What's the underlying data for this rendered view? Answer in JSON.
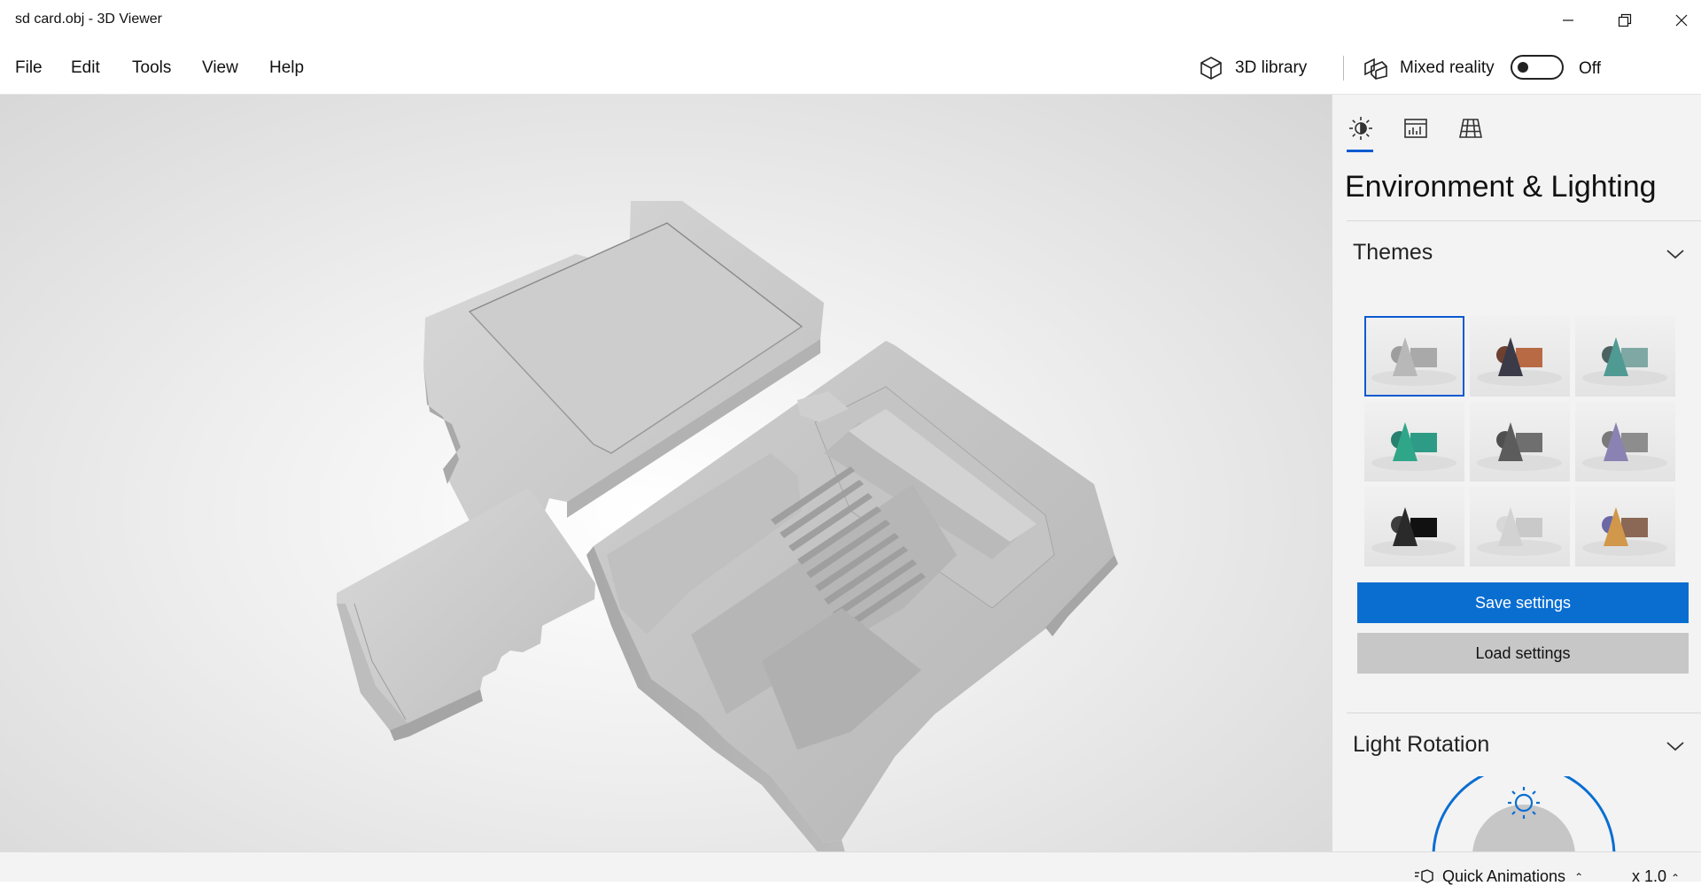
{
  "window": {
    "title": "sd card.obj - 3D Viewer"
  },
  "menu": {
    "items": [
      "File",
      "Edit",
      "Tools",
      "View",
      "Help"
    ]
  },
  "toolbar": {
    "library_label": "3D library",
    "mixed_reality_label": "Mixed reality",
    "toggle_state": "Off"
  },
  "panel": {
    "tabs": [
      "sun-icon",
      "stats-icon",
      "grid-icon"
    ],
    "title": "Environment & Lighting",
    "themes_title": "Themes",
    "save_label": "Save settings",
    "load_label": "Load settings",
    "light_rotation_title": "Light Rotation",
    "themes": [
      {
        "cone": "#b8b8b8",
        "box": "#a9a9a9",
        "sphere": "#9d9d9d"
      },
      {
        "cone": "#3a3a48",
        "box": "#b86a44",
        "sphere": "#6d4030"
      },
      {
        "cone": "#4f9a92",
        "box": "#7fa8a4",
        "sphere": "#4c6262"
      },
      {
        "cone": "#2fa688",
        "box": "#2e9b86",
        "sphere": "#27816f"
      },
      {
        "cone": "#5c5c5c",
        "box": "#6f6f6f",
        "sphere": "#4f4f4f"
      },
      {
        "cone": "#8a82b2",
        "box": "#8d8d8d",
        "sphere": "#7a7a7a"
      },
      {
        "cone": "#2a2a2a",
        "box": "#111111",
        "sphere": "#3d3d3d"
      },
      {
        "cone": "#d2d2d2",
        "box": "#c9c9c9",
        "sphere": "#d8d8d8"
      },
      {
        "cone": "#d1974a",
        "box": "#8a6855",
        "sphere": "#6b68a8"
      }
    ],
    "selected_theme_index": 0,
    "accent_color": "#0a6ed1"
  },
  "statusbar": {
    "quick_animations_label": "Quick Animations",
    "zoom_label": "x 1.0"
  }
}
